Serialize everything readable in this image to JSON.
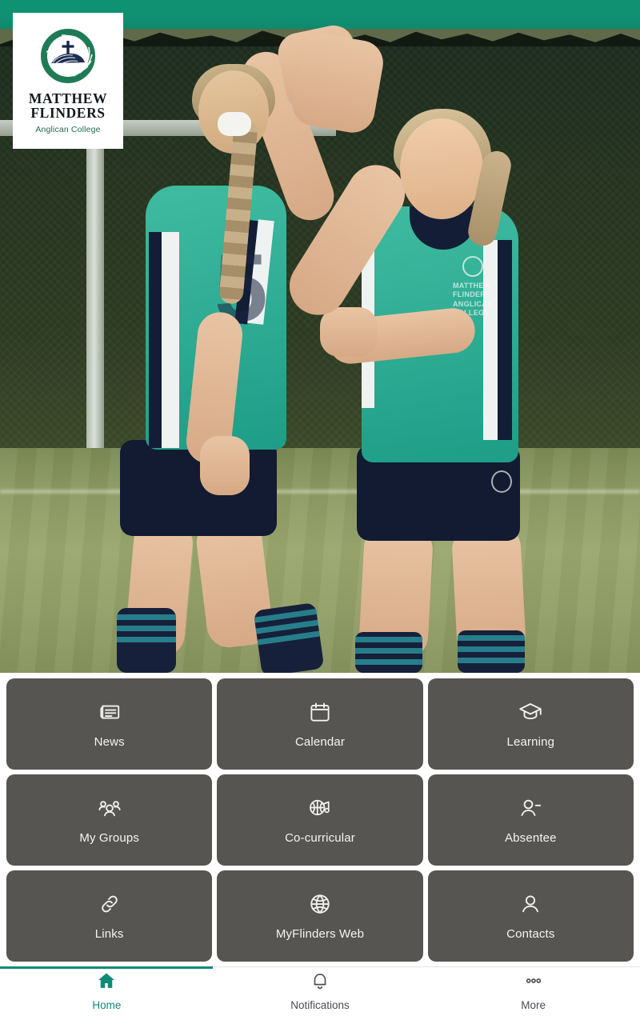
{
  "app": {
    "school_name_line1": "MATTHEW",
    "school_name_line2": "FLINDERS",
    "school_tagline": "Anglican College",
    "jersey_crest_text": "MATTHEW FLINDERS ANGLICAN COLLEGE",
    "jersey_number": "5"
  },
  "colors": {
    "accent_teal": "#0e8a78",
    "tile_background": "#575551",
    "tile_text": "#f4f4f2",
    "logo_green": "#1f6b4f",
    "logo_navy": "#14181f",
    "nav_inactive": "#4a4a52",
    "uniform_teal": "#2aa88f",
    "uniform_navy": "#131d35"
  },
  "hero": {
    "alt": "Two students in teal and navy sports uniforms high-fiving on a grass sports field"
  },
  "grid": {
    "tiles": [
      {
        "label": "News",
        "icon": "newspaper-icon"
      },
      {
        "label": "Calendar",
        "icon": "calendar-icon"
      },
      {
        "label": "Learning",
        "icon": "graduation-cap-icon"
      },
      {
        "label": "My Groups",
        "icon": "people-group-icon"
      },
      {
        "label": "Co-curricular",
        "icon": "basketball-music-icon"
      },
      {
        "label": "Absentee",
        "icon": "person-minus-icon"
      },
      {
        "label": "Links",
        "icon": "chain-link-icon"
      },
      {
        "label": "MyFlinders Web",
        "icon": "globe-icon"
      },
      {
        "label": "Contacts",
        "icon": "person-icon"
      }
    ]
  },
  "bottom_nav": {
    "active_index": 0,
    "items": [
      {
        "label": "Home",
        "icon": "home-icon",
        "active": true
      },
      {
        "label": "Notifications",
        "icon": "bell-icon",
        "active": false
      },
      {
        "label": "More",
        "icon": "ellipsis-icon",
        "active": false
      }
    ]
  }
}
